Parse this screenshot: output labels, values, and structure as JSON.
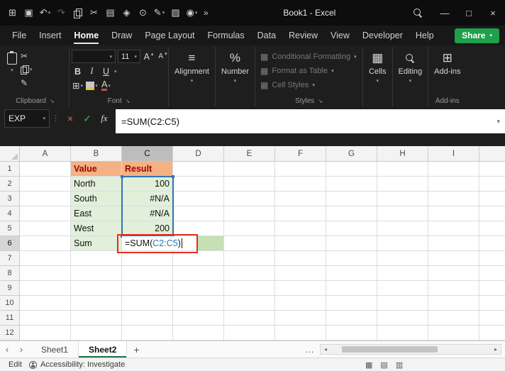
{
  "glyphs": {
    "caret_down": "▾",
    "caret_up": "▴",
    "launcher": "↘",
    "dots_vertical": "⋮",
    "cut": "✂",
    "format_painter": "✎",
    "borders": "⊞",
    "alignment_lines": "≡",
    "cells_grid": "▦",
    "addins_grid": "⊞",
    "styles_swatch": "▦",
    "more_ellipsis": "…"
  },
  "titlebar": {
    "title": "Book1 - Excel",
    "overflow": "»",
    "quick_icons": [
      {
        "name": "apps-grid-icon",
        "glyph": "⊞"
      },
      {
        "name": "save-icon",
        "glyph": "▣"
      },
      {
        "name": "undo-icon",
        "glyph": "↶",
        "caret": true
      },
      {
        "name": "redo-icon",
        "glyph": "↷",
        "dim": true
      },
      {
        "name": "copy-icon",
        "css": "i-copy"
      },
      {
        "name": "cut-icon",
        "glyph": "✂"
      },
      {
        "name": "table-icon",
        "glyph": "▤"
      },
      {
        "name": "paint-icon",
        "glyph": "◈"
      },
      {
        "name": "globe-icon",
        "glyph": "⊙"
      },
      {
        "name": "pen-icon",
        "glyph": "✎",
        "caret": true
      },
      {
        "name": "highlighter-icon",
        "glyph": "▨"
      },
      {
        "name": "camera-icon",
        "glyph": "◉",
        "caret": true
      }
    ],
    "window_controls": [
      {
        "name": "minimize-button",
        "glyph": "—"
      },
      {
        "name": "maximize-button",
        "glyph": "□"
      },
      {
        "name": "close-button",
        "glyph": "×"
      }
    ]
  },
  "menubar": {
    "tabs": [
      "File",
      "Insert",
      "Home",
      "Draw",
      "Page Layout",
      "Formulas",
      "Data",
      "Review",
      "View",
      "Developer",
      "Help"
    ],
    "active": "Home",
    "share_label": "Share"
  },
  "ribbon": {
    "clipboard": {
      "group_label": "Clipboard"
    },
    "font": {
      "group_label": "Font",
      "font_name": "",
      "font_size": "11",
      "bold": "B",
      "italic": "I",
      "underline": "U",
      "grow_font": "A",
      "shrink_font": "A",
      "font_color_letter": "A"
    },
    "alignment": {
      "label": "Alignment"
    },
    "number": {
      "label": "Number",
      "icon_glyph": "%"
    },
    "styles": {
      "group_label": "Styles",
      "items": [
        "Conditional Formatting",
        "Format as Table",
        "Cell Styles"
      ]
    },
    "cells": {
      "label": "Cells"
    },
    "editing": {
      "label": "Editing"
    },
    "addins": {
      "label": "Add-ins",
      "group_label": "Add-ins"
    }
  },
  "formula_bar": {
    "name_box": "EXP",
    "cancel": "×",
    "enter": "✓",
    "fx": "fx",
    "formula": "=SUM(C2:C5)"
  },
  "sheet": {
    "columns": [
      "A",
      "B",
      "C",
      "D",
      "E",
      "F",
      "G",
      "H",
      "I"
    ],
    "row_count": 12,
    "active_col": "C",
    "active_row": 6,
    "cells": [
      {
        "col": "B",
        "row": 1,
        "text": "Value",
        "cls": "orange"
      },
      {
        "col": "C",
        "row": 1,
        "text": "Result",
        "cls": "orange"
      },
      {
        "col": "B",
        "row": 2,
        "text": "North",
        "cls": "green"
      },
      {
        "col": "C",
        "row": 2,
        "text": "100",
        "cls": "green num"
      },
      {
        "col": "B",
        "row": 3,
        "text": "South",
        "cls": "green"
      },
      {
        "col": "C",
        "row": 3,
        "text": "#N/A",
        "cls": "green num"
      },
      {
        "col": "B",
        "row": 4,
        "text": "East",
        "cls": "green"
      },
      {
        "col": "C",
        "row": 4,
        "text": "#N/A",
        "cls": "green num"
      },
      {
        "col": "B",
        "row": 5,
        "text": "West",
        "cls": "green"
      },
      {
        "col": "C",
        "row": 5,
        "text": "200",
        "cls": "green num"
      },
      {
        "col": "B",
        "row": 6,
        "text": "Sum",
        "cls": "green"
      },
      {
        "col": "D",
        "row": 6,
        "text": "",
        "cls": "dgreen"
      }
    ],
    "edit": {
      "col": "C",
      "row": 6,
      "prefix": "=SUM(",
      "ref": "C2:C5",
      "suffix": ")"
    },
    "ref_range": {
      "col": "C",
      "row_start": 2,
      "row_end": 5
    },
    "colors": {
      "header_fill": "#F4B183",
      "header_text": "#9C0006",
      "green_fill": "#E2EFDA",
      "range_fill": "#C6E0B4",
      "ref_border": "#2E75B6",
      "edit_border": "#E0301E"
    }
  },
  "sheet_tabs": {
    "nav_left": "‹",
    "nav_right": "›",
    "tabs": [
      "Sheet1",
      "Sheet2"
    ],
    "active": "Sheet2",
    "add_label": "+",
    "more": "…"
  },
  "status_bar": {
    "mode": "Edit",
    "accessibility": "Accessibility: Investigate",
    "view_icons": [
      {
        "name": "normal-view-icon",
        "glyph": "▦"
      },
      {
        "name": "page-layout-view-icon",
        "glyph": "▤"
      },
      {
        "name": "page-break-preview-icon",
        "glyph": "▥"
      }
    ]
  }
}
